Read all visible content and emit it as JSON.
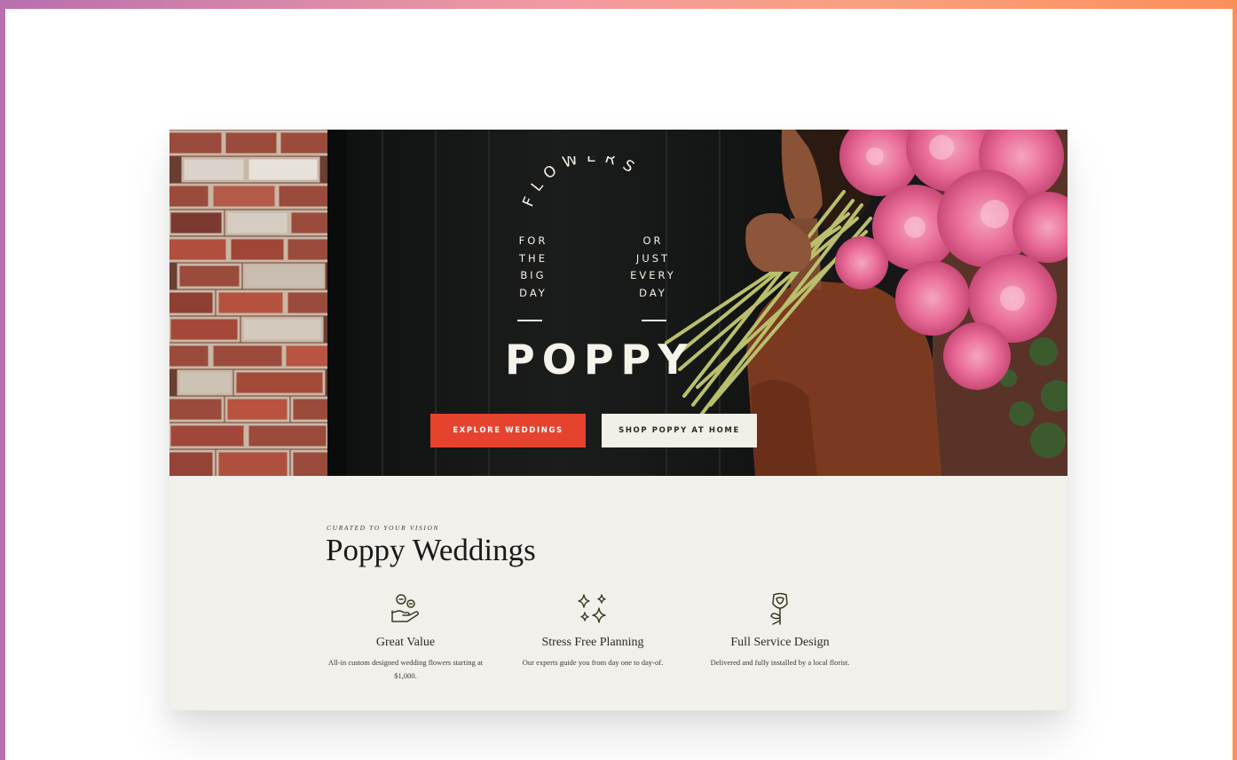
{
  "hero": {
    "arc_text": "FLOWERS",
    "tagline_left": "FOR\nTHE\nBIG\nDAY",
    "tagline_right": "OR\nJUST\nEVERY\nDAY",
    "logo": "POPPY",
    "primary_button": "EXPLORE WEDDINGS",
    "secondary_button": "SHOP POPPY AT HOME"
  },
  "section": {
    "kicker": "CURATED TO YOUR VISION",
    "title": "Poppy Weddings",
    "features": [
      {
        "icon": "hand-coins-icon",
        "title": "Great Value",
        "description": "All-in custom designed wedding flowers starting at $1,000."
      },
      {
        "icon": "sparkles-icon",
        "title": "Stress Free Planning",
        "description": "Our experts guide you from day one to day-of."
      },
      {
        "icon": "rose-icon",
        "title": "Full Service Design",
        "description": "Delivered and fully installed by a local florist."
      }
    ]
  },
  "colors": {
    "accent": "#e5432e",
    "cream": "#f2f0ea",
    "dark": "#171717"
  }
}
